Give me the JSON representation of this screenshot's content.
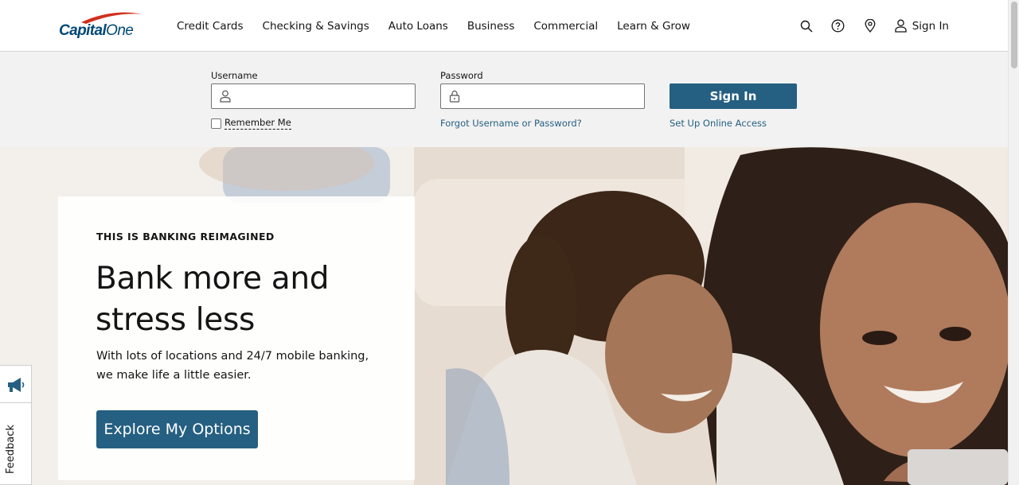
{
  "brand": {
    "name_part1": "Capital",
    "name_part2": "One"
  },
  "nav": {
    "items": [
      "Credit Cards",
      "Checking & Savings",
      "Auto Loans",
      "Business",
      "Commercial",
      "Learn & Grow"
    ]
  },
  "utility": {
    "icons": [
      "search-icon",
      "help-icon",
      "location-icon",
      "user-icon"
    ],
    "signin_label": "Sign In"
  },
  "login": {
    "username_label": "Username",
    "username_value": "",
    "password_label": "Password",
    "password_value": "",
    "remember_label": "Remember Me",
    "remember_checked": false,
    "forgot_link": "Forgot Username or Password?",
    "signin_button": "Sign In",
    "setup_link": "Set Up Online Access"
  },
  "hero": {
    "eyebrow": "THIS IS BANKING REIMAGINED",
    "title_line1": "Bank more and",
    "title_line2": "stress less",
    "subtitle_line1": "With lots of locations and 24/7 mobile banking,",
    "subtitle_line2": "we make life a little easier.",
    "cta_label": "Explore My Options"
  },
  "feedback": {
    "label": "Feedback"
  },
  "colors": {
    "brand_blue": "#004977",
    "button_blue": "#255f82",
    "login_bg": "#f2f2f2",
    "logo_swoosh": "#d22e1e"
  }
}
